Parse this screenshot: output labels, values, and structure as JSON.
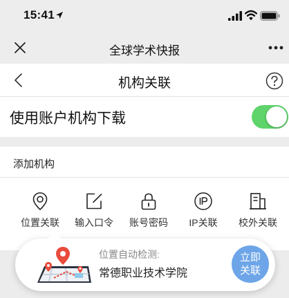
{
  "status_bar": {
    "time": "15:41"
  },
  "wechat_nav": {
    "title": "全球学术快报"
  },
  "page_nav": {
    "title": "机构关联"
  },
  "toggle_row": {
    "label": "使用账户机构下载",
    "enabled": true
  },
  "add_section": {
    "title": "添加机构",
    "methods": [
      {
        "label": "位置关联",
        "icon": "location-pin-icon"
      },
      {
        "label": "输入口令",
        "icon": "edit-icon"
      },
      {
        "label": "账号密码",
        "icon": "lock-icon"
      },
      {
        "label": "IP关联",
        "icon": "ip-icon"
      },
      {
        "label": "校外关联",
        "icon": "building-icon"
      }
    ]
  },
  "popup": {
    "detect_label": "位置自动检测:",
    "detected_institution": "常德职业技术学院",
    "button_line1": "立即",
    "button_line2": "关联"
  },
  "colors": {
    "toggle_on": "#5ed46a",
    "button_blue": "#6da5e8",
    "pin_red": "#e94b3c"
  }
}
